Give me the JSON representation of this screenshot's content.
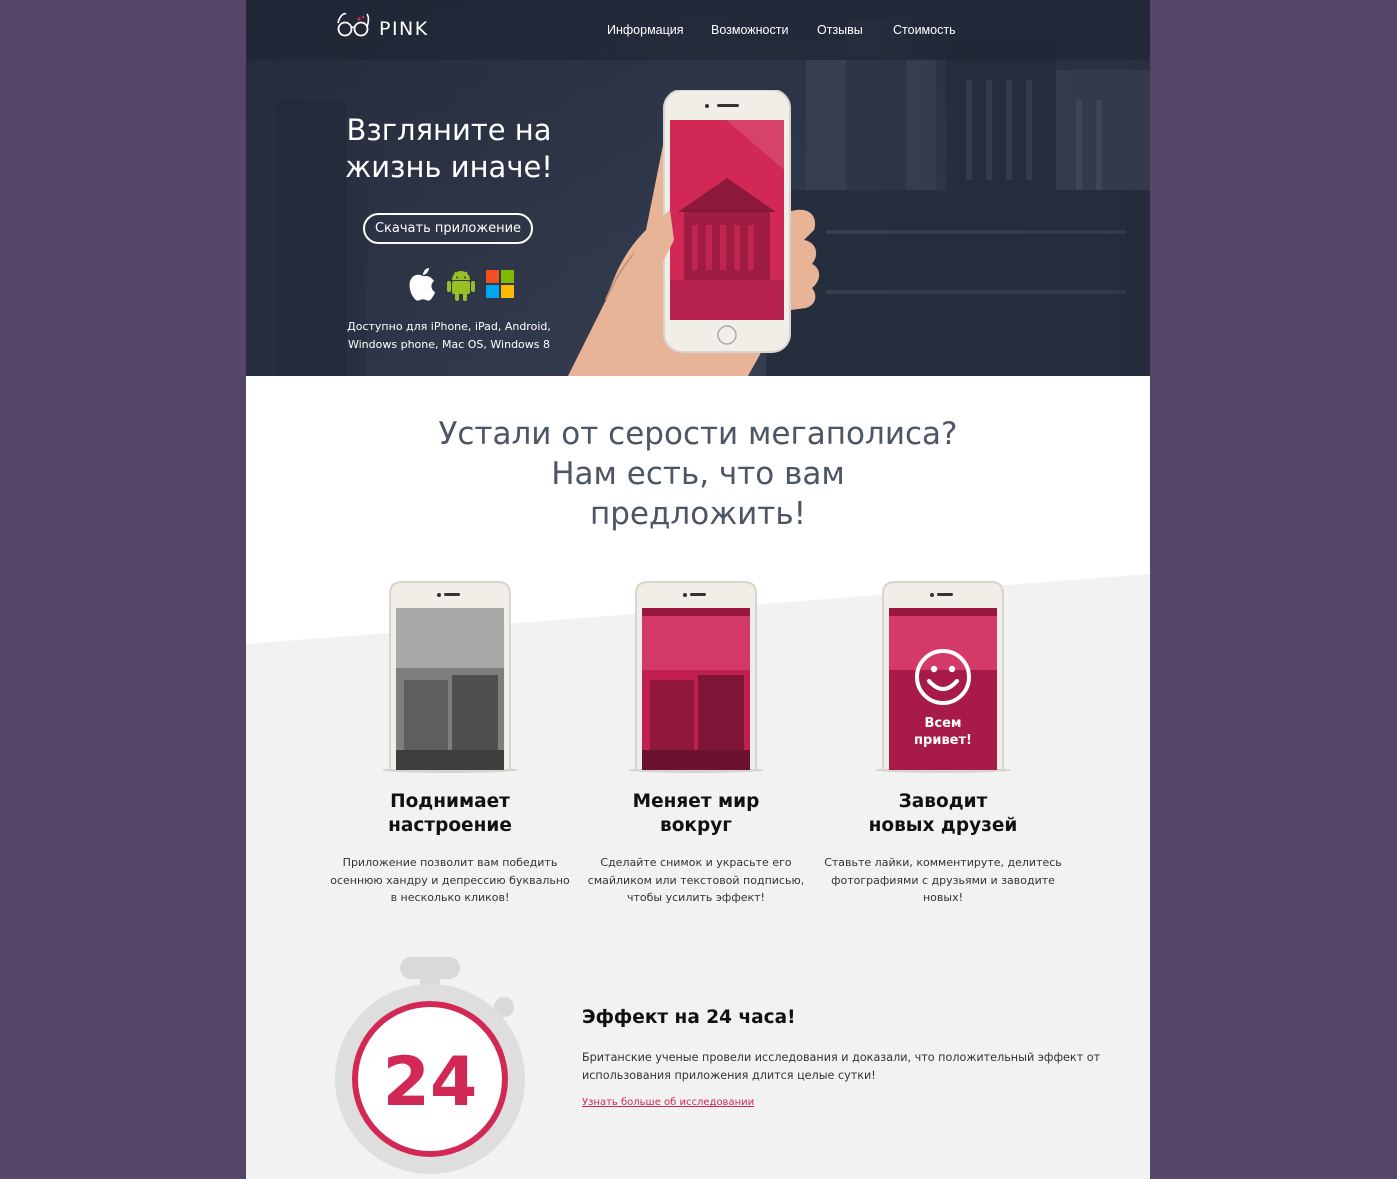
{
  "brand": {
    "name": "PINK"
  },
  "nav": {
    "items": [
      {
        "label": "Информация"
      },
      {
        "label": "Возможности"
      },
      {
        "label": "Отзывы"
      },
      {
        "label": "Стоимость"
      }
    ]
  },
  "hero": {
    "title_line1": "Взгляните на",
    "title_line2": "жизнь иначе!",
    "download_label": "Скачать приложение",
    "platform_icons": [
      "apple-icon",
      "android-icon",
      "windows-icon"
    ],
    "availability_line1": "Доступно для iPhone, iPad, Android,",
    "availability_line2": "Windows phone, Mac OS, Windows 8"
  },
  "intro": {
    "line1": "Устали от серости мегаполиса?",
    "line2": "Нам есть, что вам",
    "line3": "предложить!"
  },
  "features": [
    {
      "title_line1": "Поднимает",
      "title_line2": "настроение",
      "text_line1": "Приложение позволит вам победить",
      "text_line2": "осеннюю хандру и депрессию буквально",
      "text_line3": "в несколько кликов!"
    },
    {
      "title_line1": "Меняет мир",
      "title_line2": "вокруг",
      "text_line1": "Сделайте снимок и украсьте его",
      "text_line2": "смайликом или текстовой подписью,",
      "text_line3": "чтобы усилить эффект!"
    },
    {
      "title_line1": "Заводит",
      "title_line2": "новых друзей",
      "text_line1": "Ставьте лайки, комментируте, делитесь",
      "text_line2": "фотографиями с друзьями и заводите",
      "text_line3": "новых!",
      "screen_caption_line1": "Всем",
      "screen_caption_line2": "привет!"
    }
  ],
  "effect": {
    "timer_value": "24",
    "title": "Эффект на 24 часа!",
    "text_line1": "Британские ученые провели исследования и доказали, что положительный эффект от",
    "text_line2": "использования приложения длится целые сутки!",
    "link_label": "Узнать больше об исследовании"
  },
  "colors": {
    "page_background": "#554568",
    "accent": "#d22856",
    "hero_dark": "#2b3446",
    "text_heading": "#4c5664"
  }
}
